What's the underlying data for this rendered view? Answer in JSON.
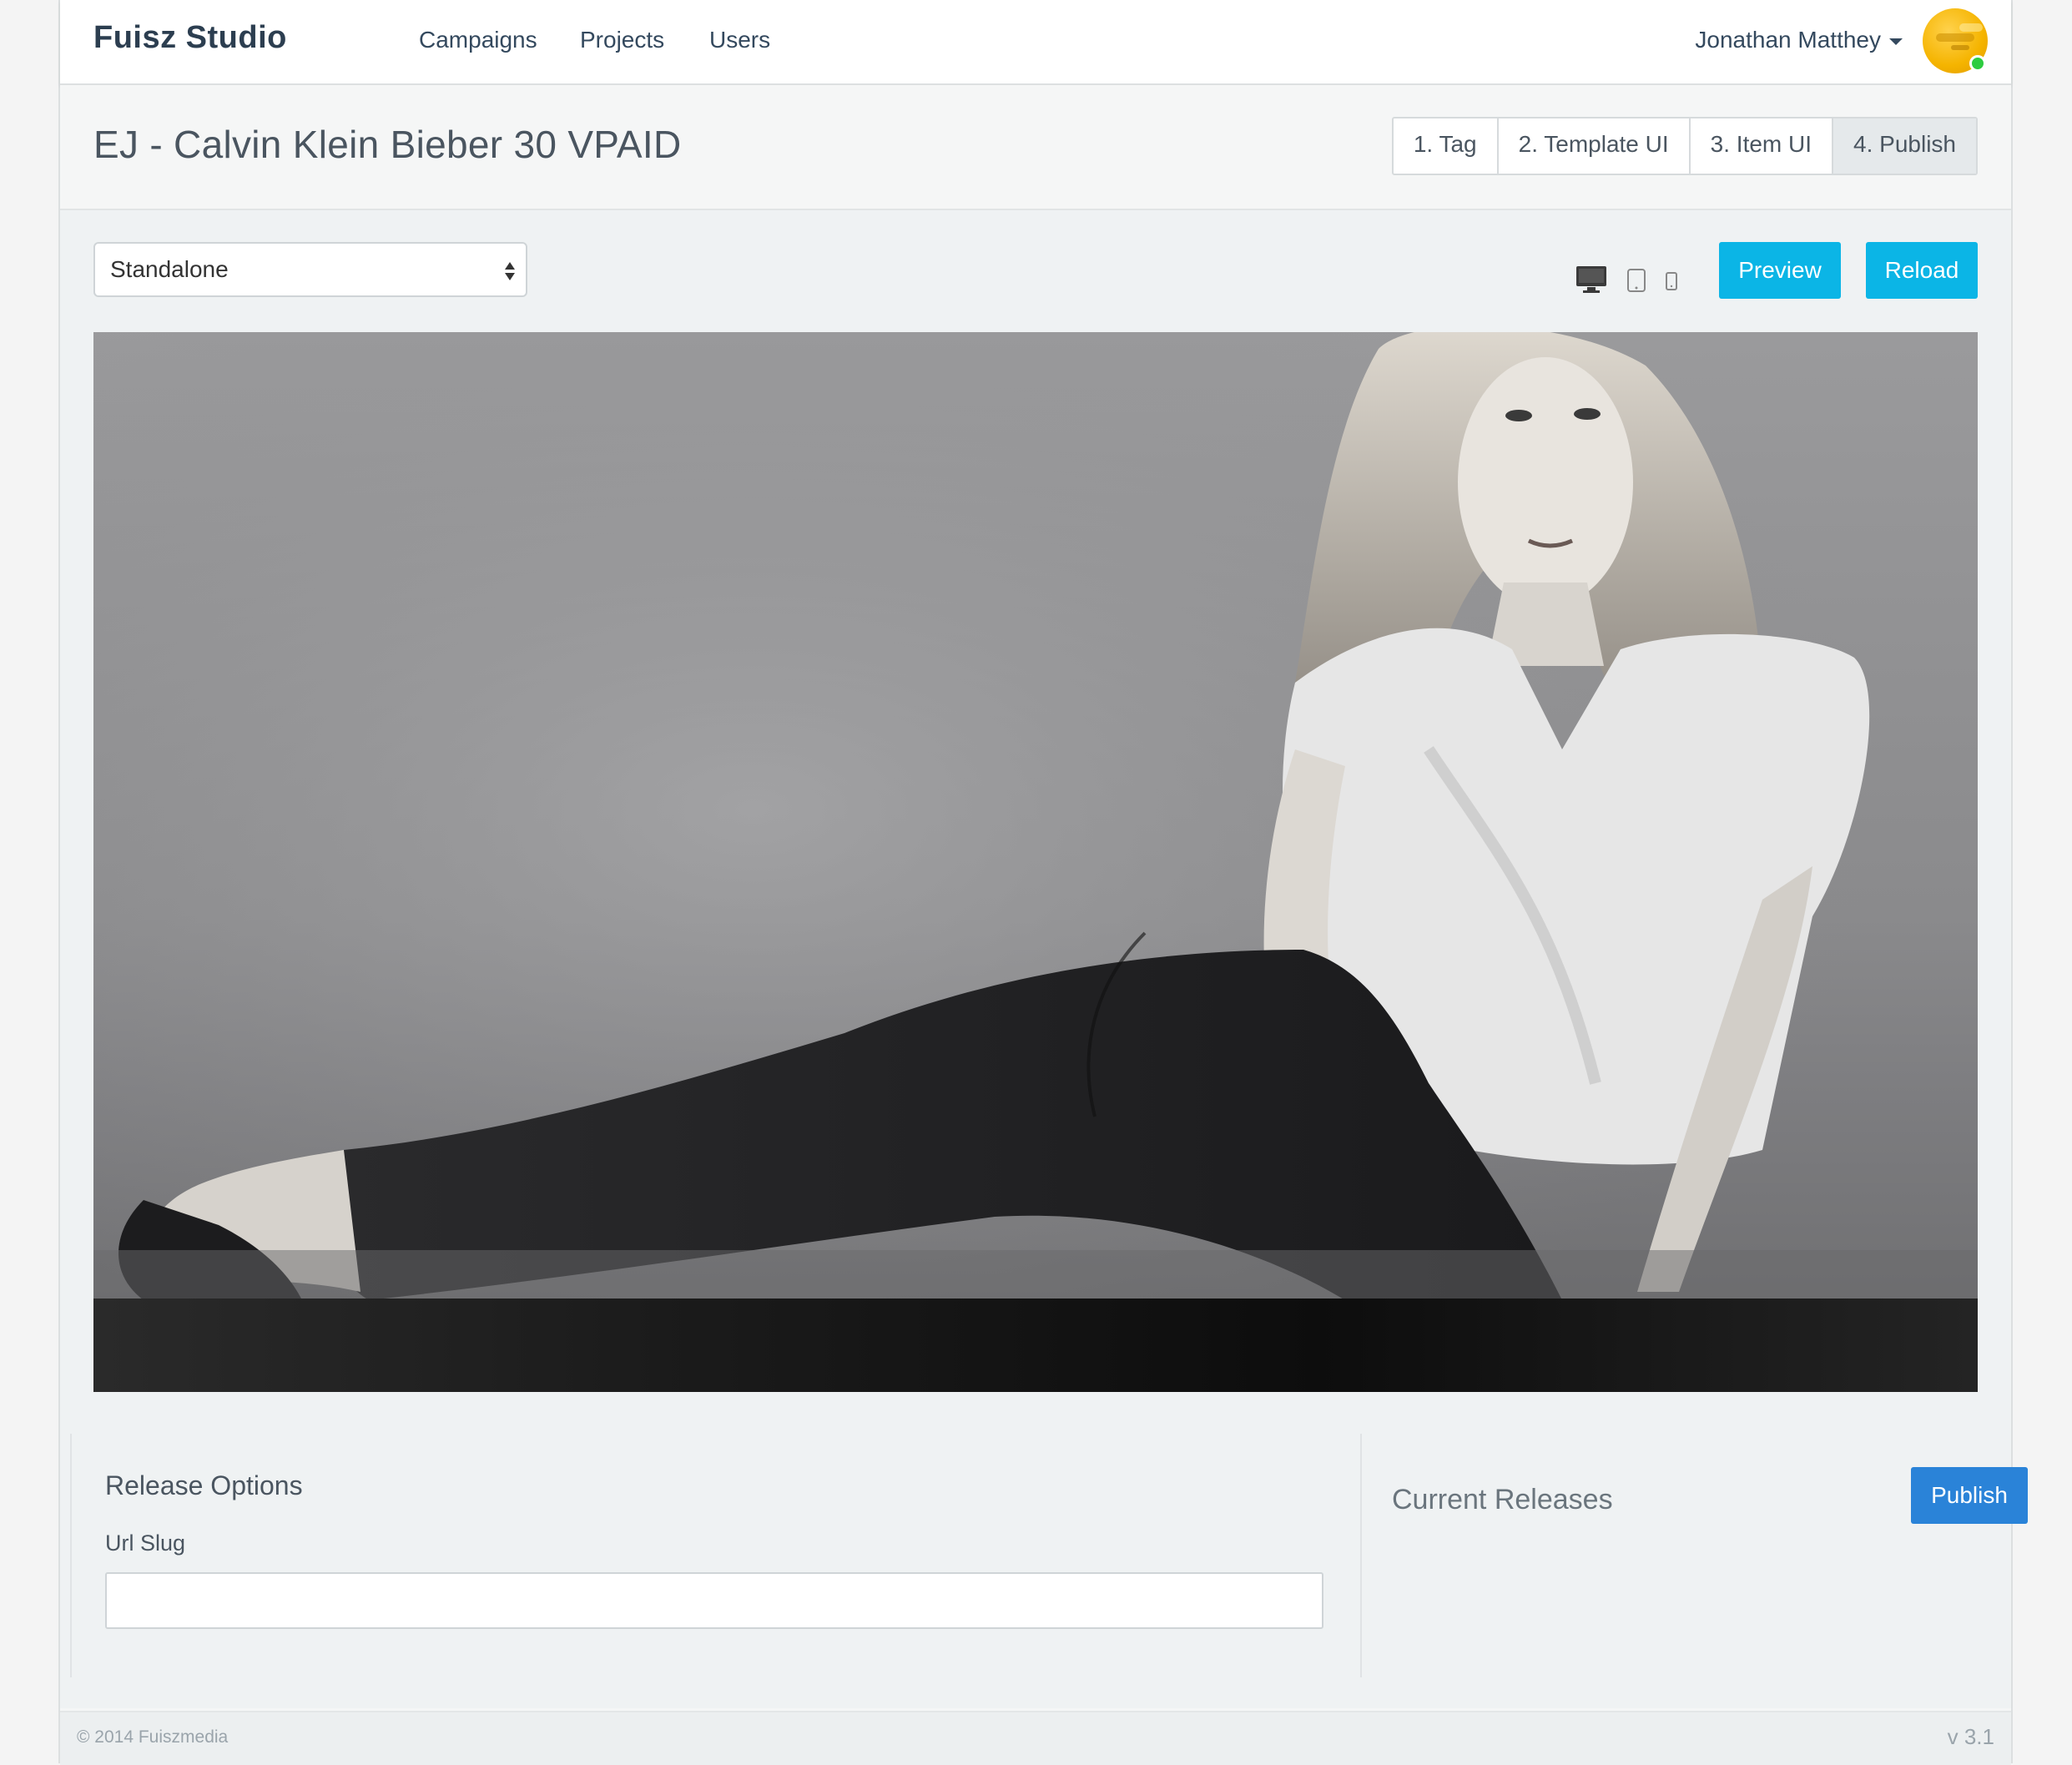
{
  "navbar": {
    "brand": "Fuisz Studio",
    "links": [
      "Campaigns",
      "Projects",
      "Users"
    ],
    "user_name": "Jonathan Matthey"
  },
  "header": {
    "title": "EJ - Calvin Klein Bieber 30 VPAID",
    "steps": [
      "1. Tag",
      "2. Template UI",
      "3. Item UI",
      "4. Publish"
    ],
    "active_step": "4. Publish"
  },
  "toolbar": {
    "format_select": "Standalone",
    "devices": [
      "desktop-icon",
      "tablet-icon",
      "phone-icon"
    ],
    "preview_label": "Preview",
    "reload_label": "Reload"
  },
  "release_options": {
    "title": "Release Options",
    "url_slug_label": "Url Slug",
    "url_slug_value": ""
  },
  "current_releases": {
    "title": "Current Releases",
    "publish_label": "Publish"
  },
  "footer": {
    "copyright": "© 2014 Fuiszmedia",
    "version": "v 3.1"
  },
  "colors": {
    "cyan_button": "#0bb5e6",
    "blue_button": "#2a83d8",
    "brand_text": "#2c3e50"
  }
}
